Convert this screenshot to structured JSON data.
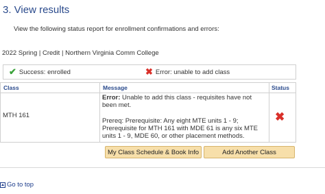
{
  "page": {
    "step_title": "3.  View results",
    "instructions": "View the following status report for enrollment confirmations and errors:",
    "term_line": "2022 Spring | Credit | Northern Virginia Comm College"
  },
  "legend": {
    "success_label": "Success: enrolled",
    "error_label": "Error: unable to add class"
  },
  "table": {
    "headers": {
      "class": "Class",
      "message": "Message",
      "status": "Status"
    },
    "rows": [
      {
        "class": "MTH  161",
        "message": {
          "error_prefix": "Error:",
          "error_text": " Unable to add this class - requisites have not been met.",
          "prereq_1": "Prereq: Prerequisite: Any eight MTE units 1 - 9;",
          "prereq_2": "Prerequisite for MTH 161 with MDE 61 is any six MTE units 1 - 9, MDE 60, or other placement methods."
        },
        "status": "error"
      }
    ]
  },
  "buttons": {
    "schedule_label": "My Class Schedule & Book Info",
    "add_another_label": "Add Another Class"
  },
  "footer": {
    "goto_top": "Go to top"
  },
  "icons": {
    "success": "check-icon",
    "error": "x-icon",
    "goto_top": "go-to-top-icon"
  },
  "colors": {
    "title_blue": "#2a4a8c",
    "success_green": "#3aa23a",
    "error_red": "#d9302a",
    "button_fill": "#f7dfaa"
  }
}
